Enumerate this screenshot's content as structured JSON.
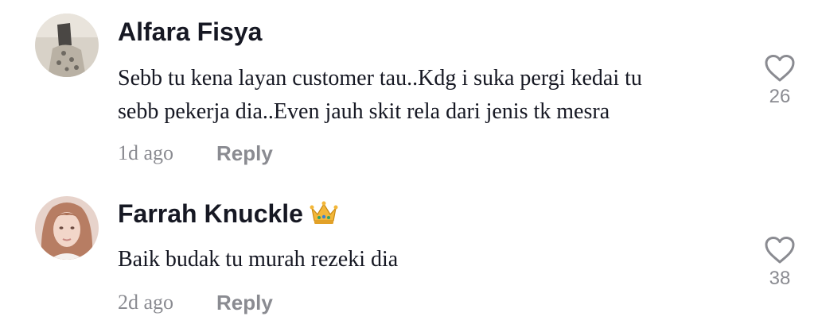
{
  "comments": [
    {
      "username": "Alfara Fisya",
      "badge": "",
      "avatar_icon": "avatar-photo",
      "text_lines": [
        "Sebb tu kena layan customer tau..Kdg i suka pergi kedai tu",
        "sebb pekerja dia..Even jauh skit rela dari jenis tk mesra"
      ],
      "time": "1d ago",
      "reply_label": "Reply",
      "likes": "26"
    },
    {
      "username": "Farrah Knuckle",
      "badge": "crown-emoji",
      "avatar_icon": "avatar-photo",
      "text_lines": [
        "Baik budak tu murah rezeki dia"
      ],
      "time": "2d ago",
      "reply_label": "Reply",
      "likes": "38"
    }
  ],
  "colors": {
    "primary_text": "#161823",
    "secondary_text": "#8a8b91",
    "background": "#ffffff"
  }
}
